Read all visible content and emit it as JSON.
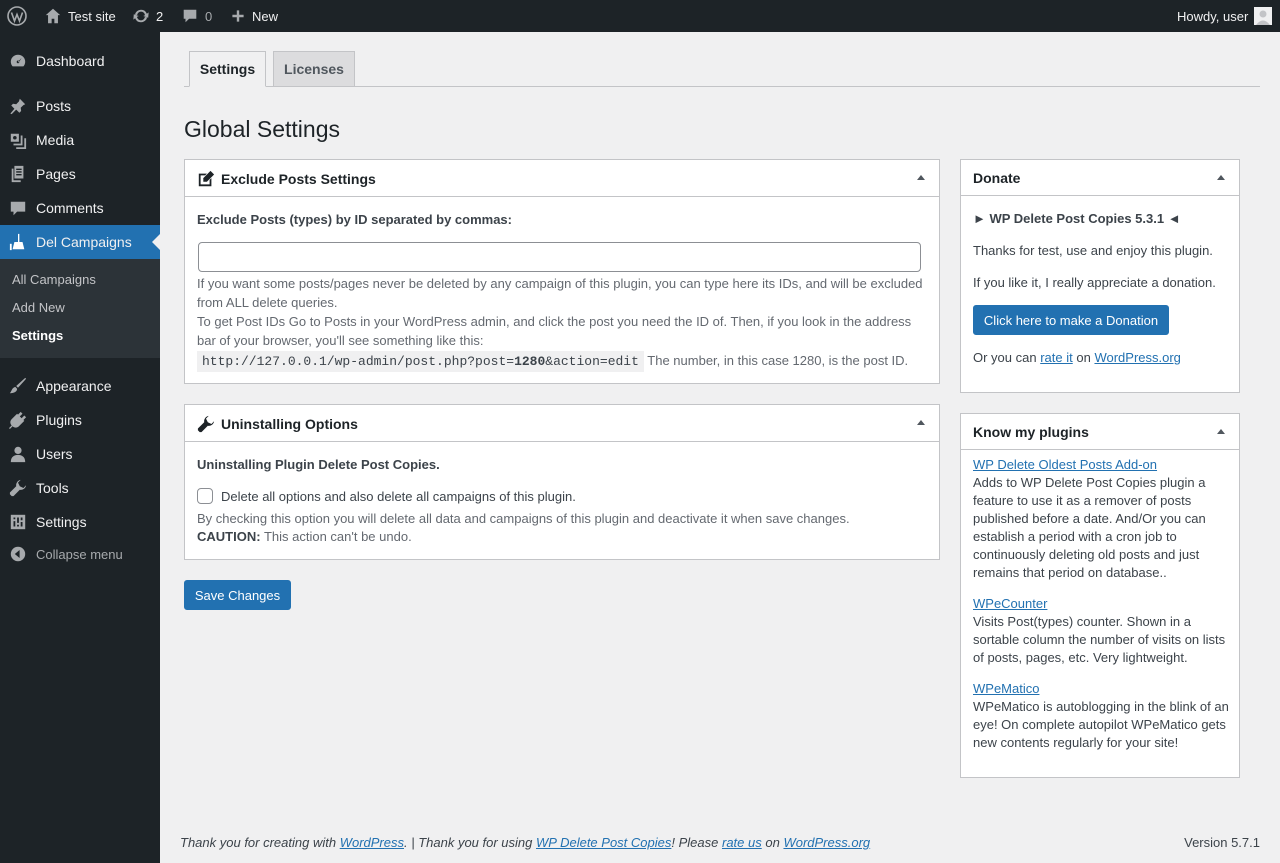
{
  "adminbar": {
    "site_name": "Test site",
    "updates_count": "2",
    "comments_count": "0",
    "new_label": "New",
    "howdy": "Howdy, user"
  },
  "sidebar": {
    "items": [
      {
        "label": "Dashboard",
        "icon": "dashboard-icon"
      },
      {
        "label": "Posts",
        "icon": "pin-icon"
      },
      {
        "label": "Media",
        "icon": "media-icon"
      },
      {
        "label": "Pages",
        "icon": "pages-icon"
      },
      {
        "label": "Comments",
        "icon": "comments-icon"
      },
      {
        "label": "Del Campaigns",
        "icon": "broom-icon"
      },
      {
        "label": "Appearance",
        "icon": "brush-icon"
      },
      {
        "label": "Plugins",
        "icon": "plug-icon"
      },
      {
        "label": "Users",
        "icon": "user-icon"
      },
      {
        "label": "Tools",
        "icon": "wrench-icon"
      },
      {
        "label": "Settings",
        "icon": "settings-icon"
      }
    ],
    "submenu": [
      "All Campaigns",
      "Add New",
      "Settings"
    ],
    "collapse_label": "Collapse menu"
  },
  "tabs": [
    "Settings",
    "Licenses"
  ],
  "page_title": "Global Settings",
  "exclude_box": {
    "title": "Exclude Posts Settings",
    "label": "Exclude Posts (types) by ID separated by commas:",
    "input_value": "",
    "help1": "If you want some posts/pages never be deleted by any campaign of this plugin, you can type here its IDs, and will be excluded from ALL delete queries.",
    "help2": "To get Post IDs Go to Posts in your WordPress admin, and click the post you need the ID of. Then, if you look in the address bar of your browser, you'll see something like this:",
    "url_prefix": "http://127.0.0.1/wp-admin/post.php?post=",
    "url_id": "1280",
    "url_suffix": "&action=edit",
    "help3": "The number, in this case 1280, is the post ID."
  },
  "uninstall_box": {
    "title": "Uninstalling Options",
    "heading": "Uninstalling Plugin Delete Post Copies.",
    "checkbox_label": "Delete all options and also delete all campaigns of this plugin.",
    "help": "By checking this option you will delete all data and campaigns of this plugin and deactivate it when save changes.",
    "caution_label": "CAUTION:",
    "caution_text": "This action can't be undo."
  },
  "save_button": "Save Changes",
  "donate_box": {
    "title": "Donate",
    "version_line": "► WP Delete Post Copies 5.3.1 ◄",
    "thanks": "Thanks for test, use and enjoy this plugin.",
    "appreciate": "If you like it, I really appreciate a donation.",
    "button": "Click here to make a Donation",
    "rate_prefix": "Or you can",
    "rate_link": "rate it",
    "rate_on": "on",
    "rate_site": "WordPress.org"
  },
  "plugins_box": {
    "title": "Know my plugins",
    "plugins": [
      {
        "name": "WP Delete Oldest Posts Add-on",
        "desc": "Adds to WP Delete Post Copies plugin a feature to use it as a remover of posts published before a date. And/Or you can establish a period with a cron job to continuously deleting old posts and just remains that period on database.."
      },
      {
        "name": "WPeCounter",
        "desc": "Visits Post(types) counter. Shown in a sortable column the number of visits on lists of posts, pages, etc. Very lightweight."
      },
      {
        "name": "WPeMatico",
        "desc": "WPeMatico is autoblogging in the blink of an eye! On complete autopilot WPeMatico gets new contents regularly for your site!"
      }
    ]
  },
  "footer": {
    "t1": "Thank you for creating with",
    "l1": "WordPress",
    "t2": ". | Thank you for using",
    "l2": "WP Delete Post Copies",
    "t3": "! Please",
    "l3": "rate us",
    "t4": "on",
    "l4": "WordPress.org",
    "version": "Version 5.7.1"
  }
}
